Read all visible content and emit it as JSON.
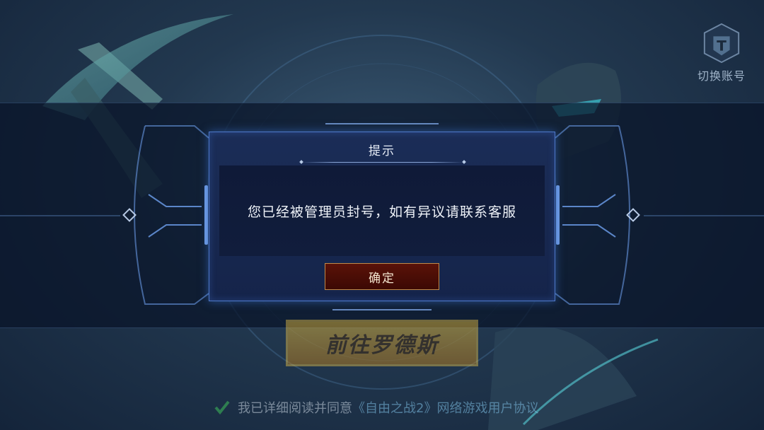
{
  "top_right": {
    "switch_account_label": "切换账号",
    "icon": "helmet-icon"
  },
  "background": {
    "start_button_label": "前往罗德斯",
    "agreement_prefix": "我已详细阅读并同意",
    "agreement_link": "《自由之战2》网络游戏用户协议",
    "agreement_checked": true
  },
  "dialog": {
    "title": "提示",
    "message": "您已经被管理员封号，如有异议请联系客服",
    "confirm_label": "确定"
  },
  "colors": {
    "dialog_bg": "#1b2d57",
    "frame_glow": "#4e78c8",
    "confirm_bg": "#4a0e06",
    "start_button": "#e9b53a",
    "check_green": "#3fbf5a"
  }
}
